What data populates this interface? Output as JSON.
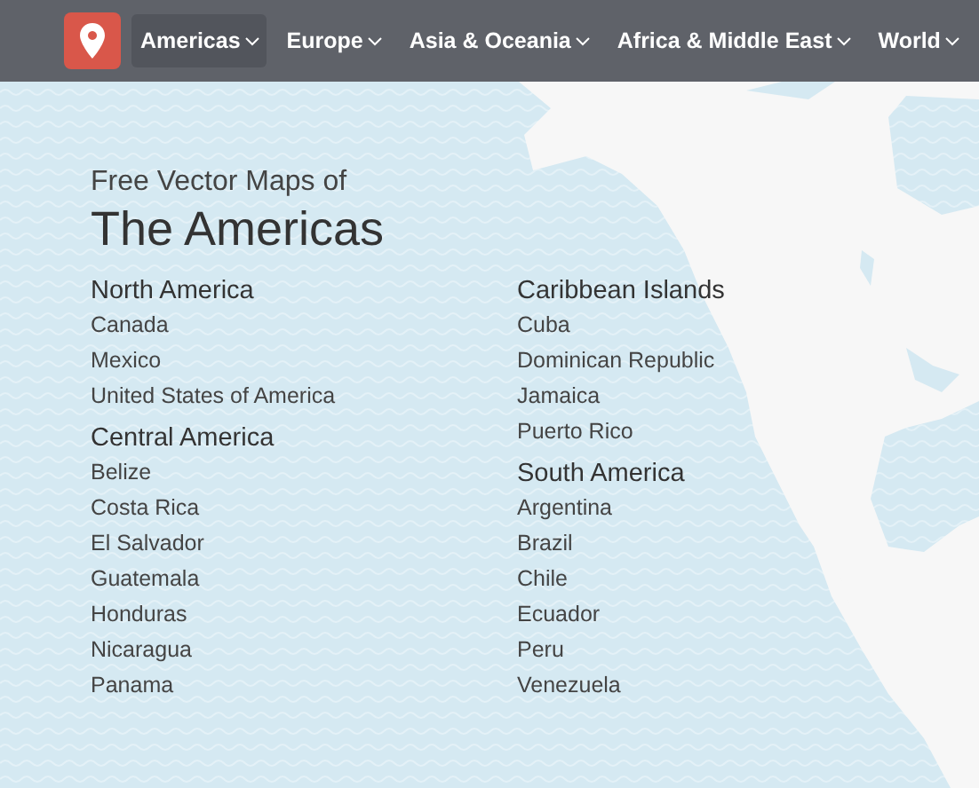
{
  "nav": {
    "items": [
      {
        "label": "Americas",
        "selected": true
      },
      {
        "label": "Europe",
        "selected": false
      },
      {
        "label": "Asia & Oceania",
        "selected": false
      },
      {
        "label": "Africa & Middle East",
        "selected": false
      },
      {
        "label": "World",
        "selected": false
      }
    ]
  },
  "intro": {
    "subtitle": "Free Vector Maps of",
    "title": "The Americas"
  },
  "columns": [
    [
      {
        "heading": "North America",
        "countries": [
          "Canada",
          "Mexico",
          "United States of America"
        ]
      },
      {
        "heading": "Central America",
        "countries": [
          "Belize",
          "Costa Rica",
          "El Salvador",
          "Guatemala",
          "Honduras",
          "Nicaragua",
          "Panama"
        ]
      }
    ],
    [
      {
        "heading": "Caribbean Islands",
        "countries": [
          "Cuba",
          "Dominican Republic",
          "Jamaica",
          "Puerto Rico"
        ]
      },
      {
        "heading": "South America",
        "countries": [
          "Argentina",
          "Brazil",
          "Chile",
          "Ecuador",
          "Peru",
          "Venezuela"
        ]
      }
    ]
  ]
}
